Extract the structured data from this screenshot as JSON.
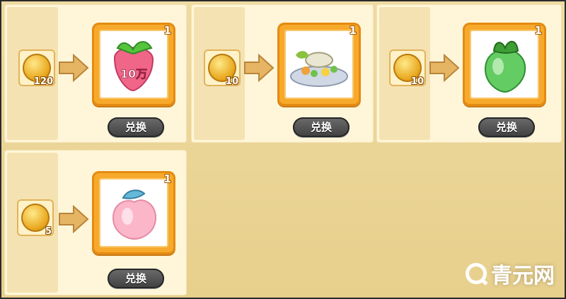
{
  "exchange": {
    "items": [
      {
        "cost": "120",
        "count": "1",
        "button": "兑换",
        "item_icon": "strawberry-10wan-icon",
        "item_text": "10万"
      },
      {
        "cost": "10",
        "count": "1",
        "button": "兑换",
        "item_icon": "vegetable-plate-icon"
      },
      {
        "cost": "10",
        "count": "1",
        "button": "兑换",
        "item_icon": "green-radish-icon"
      },
      {
        "cost": "5",
        "count": "1",
        "button": "兑换",
        "item_icon": "peach-icon"
      }
    ]
  },
  "watermark": {
    "text": "青元网"
  },
  "colors": {
    "frame": "#eedba2",
    "item_border": "#f7a92b",
    "button": "#4f4f4f"
  }
}
